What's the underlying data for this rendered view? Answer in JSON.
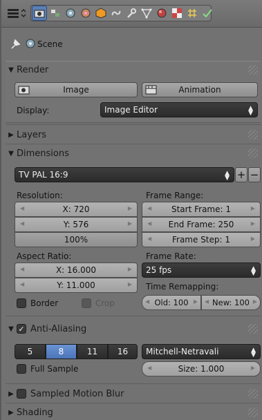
{
  "scene": {
    "label": "Scene"
  },
  "render": {
    "header": "Render",
    "image_button": "Image",
    "animation_button": "Animation",
    "display_label": "Display:",
    "display_value": "Image Editor"
  },
  "layers": {
    "header": "Layers"
  },
  "dimensions": {
    "header": "Dimensions",
    "preset": "TV PAL 16:9",
    "resolution_label": "Resolution:",
    "res_x": "X: 720",
    "res_y": "Y: 576",
    "res_pct": "100%",
    "aspect_label": "Aspect Ratio:",
    "aspect_x": "X: 16.000",
    "aspect_y": "Y: 11.000",
    "border_label": "Border",
    "crop_label": "Crop",
    "frame_range_label": "Frame Range:",
    "start_frame": "Start Frame: 1",
    "end_frame": "End Frame: 250",
    "frame_step": "Frame Step: 1",
    "frame_rate_label": "Frame Rate:",
    "frame_rate_value": "25 fps",
    "time_remap_label": "Time Remapping:",
    "old_value": "Old: 100",
    "new_value": "New: 100"
  },
  "antialiasing": {
    "header": "Anti-Aliasing",
    "samples": [
      "5",
      "8",
      "11",
      "16"
    ],
    "selected_sample": "8",
    "filter_value": "Mitchell-Netravali",
    "full_sample_label": "Full Sample",
    "size_value": "Size: 1.000"
  },
  "motion_blur": {
    "header": "Sampled Motion Blur"
  },
  "shading": {
    "header": "Shading"
  },
  "colors": {
    "accent": "#5b7fb4",
    "panel": "#727272"
  }
}
